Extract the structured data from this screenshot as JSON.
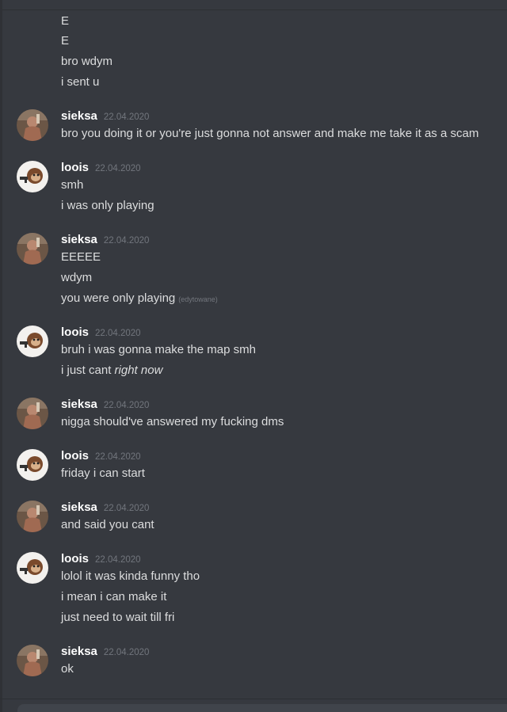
{
  "messages_top": [
    "E",
    "E",
    "bro wdym",
    "i sent u"
  ],
  "groups": [
    {
      "author": "sieksa",
      "time": "22.04.2020",
      "lines": [
        "bro you doing it or you're just gonna not answer and make me take it as a scam"
      ]
    },
    {
      "author": "loois",
      "time": "22.04.2020",
      "lines": [
        "smh",
        "i was only playing"
      ]
    },
    {
      "author": "sieksa",
      "time": "22.04.2020",
      "lines": [
        "EEEEE",
        "wdym",
        "you were only playing"
      ],
      "edited": "(edytowane)"
    },
    {
      "author": "loois",
      "time": "22.04.2020",
      "lines": [
        "bruh i was gonna make the map smh",
        "i just cant"
      ],
      "italic": "right now"
    },
    {
      "author": "sieksa",
      "time": "22.04.2020",
      "lines": [
        "nigga should've answered my fucking dms"
      ]
    },
    {
      "author": "loois",
      "time": "22.04.2020",
      "lines": [
        "friday i can start"
      ]
    },
    {
      "author": "sieksa",
      "time": "22.04.2020",
      "lines": [
        "and said you cant"
      ]
    },
    {
      "author": "loois",
      "time": "22.04.2020",
      "lines": [
        "lolol it was kinda funny tho",
        "i mean i can make it",
        "just need to wait till fri"
      ]
    },
    {
      "author": "sieksa",
      "time": "22.04.2020",
      "lines": [
        "ok"
      ]
    }
  ],
  "colors": {
    "background": "#36393f",
    "text": "#dcddde",
    "username": "#ffffff",
    "timestamp": "#72767d"
  }
}
